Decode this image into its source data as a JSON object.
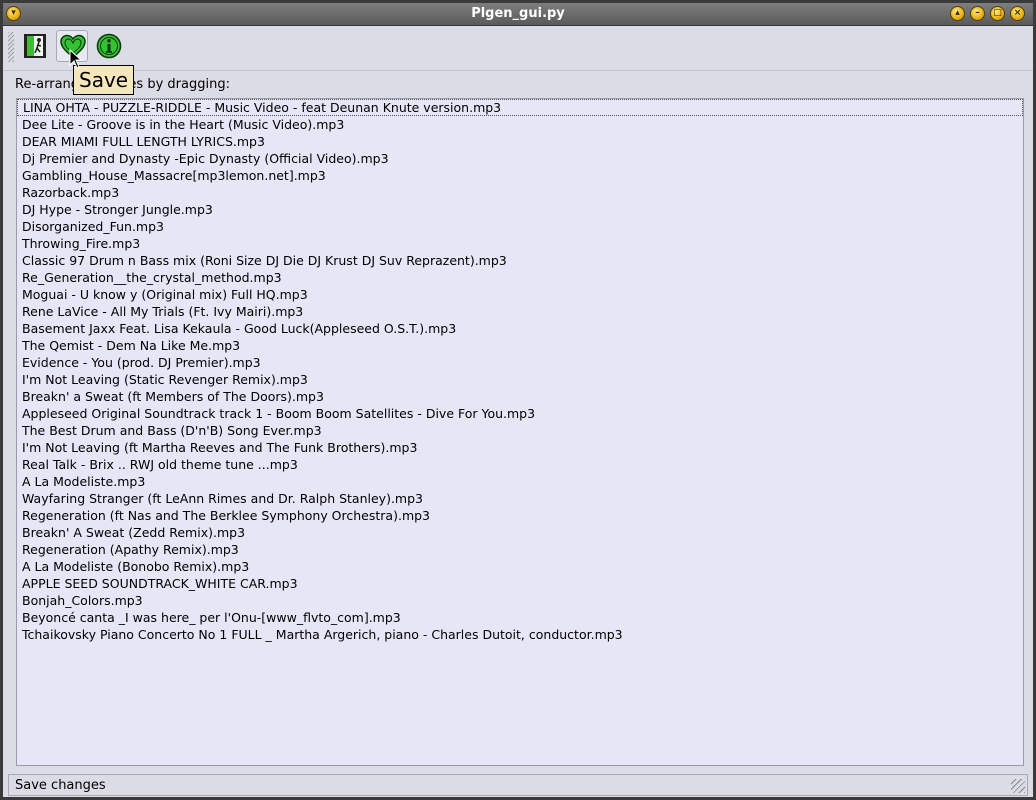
{
  "window": {
    "title": "Plgen_gui.py"
  },
  "toolbar": {
    "buttons": [
      {
        "icon": "exit-door-icon"
      },
      {
        "icon": "heart-save-icon"
      },
      {
        "icon": "info-icon"
      }
    ],
    "tooltip": "Save"
  },
  "instructions": "Re-arrange the files by dragging:",
  "playlist": {
    "items": [
      "LINA OHTA - PUZZLE-RIDDLE - Music Video - feat  Deunan Knute version.mp3",
      "Dee Lite - Groove is in the Heart (Music Video).mp3",
      "DEAR MIAMI FULL LENGTH   LYRICS.mp3",
      "Dj Premier and Dynasty -Epic Dynasty (Official Video).mp3",
      "Gambling_House_Massacre[mp3lemon.net].mp3",
      "Razorback.mp3",
      "DJ Hype - Stronger Jungle.mp3",
      "Disorganized_Fun.mp3",
      "Throwing_Fire.mp3",
      "Classic 97 Drum n Bass mix (Roni Size DJ Die DJ Krust DJ Suv Reprazent).mp3",
      "Re_Generation__the_crystal_method.mp3",
      "Moguai - U know y (Original mix) Full HQ.mp3",
      "Rene LaVice - All My Trials (Ft. Ivy Mairi).mp3",
      "Basement Jaxx Feat. Lisa Kekaula - Good Luck(Appleseed O.S.T.).mp3",
      "The Qemist - Dem Na Like Me.mp3",
      "Evidence - You (prod. DJ Premier).mp3",
      "I'm Not Leaving (Static Revenger Remix).mp3",
      "Breakn' a Sweat (ft Members of The Doors).mp3",
      "Appleseed Original Soundtrack track 1 - Boom Boom Satellites - Dive For You.mp3",
      "The Best Drum and Bass (D'n'B) Song Ever.mp3",
      "I'm Not Leaving (ft Martha Reeves and The Funk Brothers).mp3",
      "Real Talk - Brix .. RWJ old theme tune ...mp3",
      "A La Modeliste.mp3",
      "Wayfaring Stranger (ft LeAnn Rimes and Dr. Ralph Stanley).mp3",
      "Regeneration (ft Nas and The Berklee Symphony Orchestra).mp3",
      "Breakn' A Sweat (Zedd Remix).mp3",
      "Regeneration (Apathy Remix).mp3",
      "A La Modeliste (Bonobo Remix).mp3",
      "APPLE SEED SOUNDTRACK_WHITE CAR.mp3",
      "Bonjah_Colors.mp3",
      "Beyoncé canta _I was here_ per l'Onu-[www_flvto_com].mp3",
      "Tchaikovsky Piano Concerto No 1 FULL _ Martha Argerich, piano - Charles Dutoit, conductor.mp3"
    ]
  },
  "statusbar": {
    "text": "Save changes"
  },
  "colors": {
    "accent": "#e0a800",
    "list_bg": "#e6e6f6",
    "tooltip_bg": "#f5e6bc",
    "icon_green": "#34c234"
  }
}
